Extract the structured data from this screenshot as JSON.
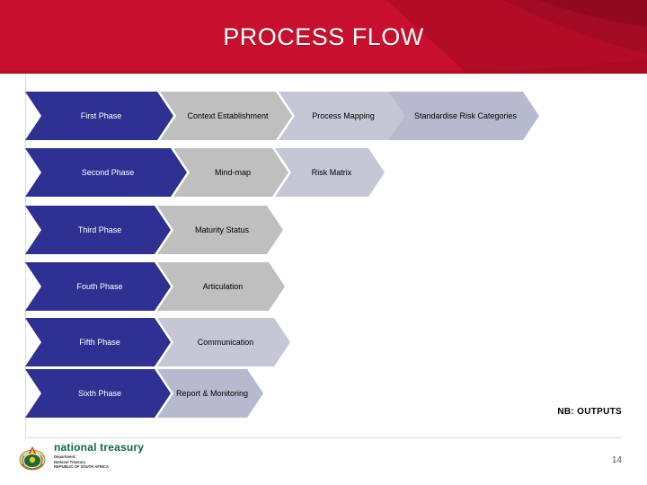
{
  "slide": {
    "title": "PROCESS FLOW",
    "note": "NB: OUTPUTS",
    "number": "14"
  },
  "colors": {
    "banner": "#C8102E",
    "banner_dark": "#9E0B23",
    "phase_fill": "#2E3192",
    "step_fill_1": "#BFBFBF",
    "step_fill_2": "#C5C6D6",
    "step_fill_3": "#B7BACE"
  },
  "process": {
    "rows": [
      {
        "phase": "First Phase",
        "steps": [
          "Context Establishment",
          "Process Mapping",
          "Standardise Risk Categories"
        ]
      },
      {
        "phase": "Second Phase",
        "steps": [
          "Mind-map",
          "Risk Matrix"
        ]
      },
      {
        "phase": "Third Phase",
        "steps": [
          "Maturity Status"
        ]
      },
      {
        "phase": "Fouth Phase",
        "steps": [
          "Articulation"
        ]
      },
      {
        "phase": "Fifth Phase",
        "steps": [
          "Communication"
        ]
      },
      {
        "phase": "Sixth Phase",
        "steps": [
          "Report & Monitoring"
        ]
      }
    ]
  },
  "footer": {
    "org_name": "national treasury",
    "org_lines": [
      "Department:",
      "National Treasury",
      "REPUBLIC OF SOUTH AFRICA"
    ]
  }
}
